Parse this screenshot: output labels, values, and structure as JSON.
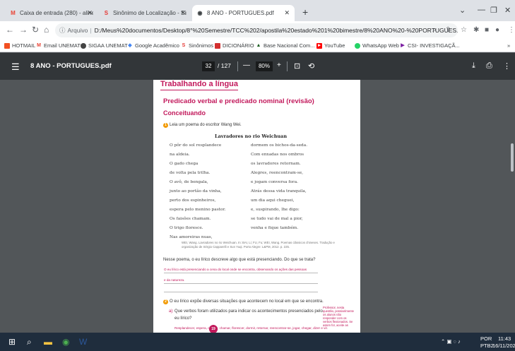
{
  "browser": {
    "tabs": [
      {
        "label": "Caixa de entrada (280) - aline.sc",
        "icon": "gmail-icon"
      },
      {
        "label": "Sinônimo de Localização - Sinôn",
        "icon": "sinonimos-icon"
      },
      {
        "label": "8 ANO - PORTUGUES.pdf",
        "icon": "chrome-icon"
      }
    ],
    "new_tab": "+",
    "address_prefix": "Arquivo",
    "address_url": "D:/Meus%20documentos/Desktop/8°%20Semestre/TCC%202/apostila%20estado%201%20bimestre/8%20ANO%20-%20PORTUGUES.pdf",
    "bookmarks": [
      {
        "label": "HOTMAIL",
        "color": "#f25022"
      },
      {
        "label": "Email UNEMAT",
        "color": "#ea4335"
      },
      {
        "label": "SIGAA UNEMAT",
        "color": "#444444"
      },
      {
        "label": "Google Acadêmico",
        "color": "#4285f4"
      },
      {
        "label": "Sinônimos",
        "color": "#e53935"
      },
      {
        "label": "DICIONÁRIO",
        "color": "#d32f2f"
      },
      {
        "label": "Base Nacional Com...",
        "color": "#1b5e20"
      },
      {
        "label": "YouTube",
        "color": "#ff0000"
      },
      {
        "label": "WhatsApp Web",
        "color": "#25d366"
      },
      {
        "label": "CSI- INVESTIGAÇÃ...",
        "color": "#7b1fa2"
      }
    ],
    "bookmarks_more": "»"
  },
  "pdf": {
    "title": "8 ANO - PORTUGUES.pdf",
    "page_current": "32",
    "page_total": "/ 127",
    "zoom": "80%",
    "minus": "—",
    "plus": "+"
  },
  "page": {
    "section": "Trabalhando a língua",
    "heading": "Predicado verbal e predicado nominal (revisão)",
    "subheading": "Conceituando",
    "q1_num": "1",
    "q1_text": "Leia um poema do escritor Wang Wei.",
    "poem_title": "Lavradores no rio Weichuan",
    "poem_left": [
      "O pôr do sol resplandece",
      "na aldeia.",
      "O gado chega",
      "de volta pela trilha.",
      "O avô, de bengala,",
      "junto ao portão da vinha,",
      "perto dos espinheiros,",
      "espera pelo menino pastor.",
      "Os faisões chamam.",
      "O trigo floresce.",
      "Nas amoreiras nuas,"
    ],
    "poem_right": [
      "dormem os bichos-da-seda.",
      "Com enxadas nos ombros",
      "os lavradores retornam.",
      "Alegres, reencontram-se,",
      "e jogam conversa fora.",
      "Atrás dessa vida tranquila,",
      "um dia aqui cheguei,",
      "e, suspirando, lhe digo:",
      "se tudo vai de mal a pior,",
      "venha e fique também."
    ],
    "credit": "WEI, Wang. Lavradores no rio Weichuan. In: BAI, Li; FU, Fu; WEI, Wang. Poemas clássicos chineses. Tradução e organização de Sérgio Capparelli e Sun Yuqi. Porto Alegre: L&PM, 2012. p. 225.",
    "q_a_prompt": "Nesse poema, o eu lírico descreve algo que está presenciando. Do que se trata?",
    "q_a_answer1": "O eu lírico está presenciando a cena do local onde se encontra, observando os ações das pessoas",
    "q_a_answer2": "e da natureza.",
    "q2_num": "2",
    "q2_text": "O eu lírico expõe diversas situações que acontecem no local em que se encontra.",
    "q2a_label": "a)",
    "q2a_text1": "Que verbos foram utilizados para indicar os acontecimentos presenciados pelo",
    "q2a_text2": "eu lírico?",
    "q2a_answer": "Resplandecer, espera, chegar, chamar, florescer, dormir, retornar, reencontrar-se, jogar, chegar, dizer e vir.",
    "side_note": "Professor, nesta questão, possivelmente os alunos não responder com os verbos flexionados. Se assim for, aceite as",
    "page_number": "19"
  },
  "taskbar": {
    "lang1": "POR",
    "lang2": "PTB2",
    "time": "11:43",
    "date": "16/11/2022"
  }
}
